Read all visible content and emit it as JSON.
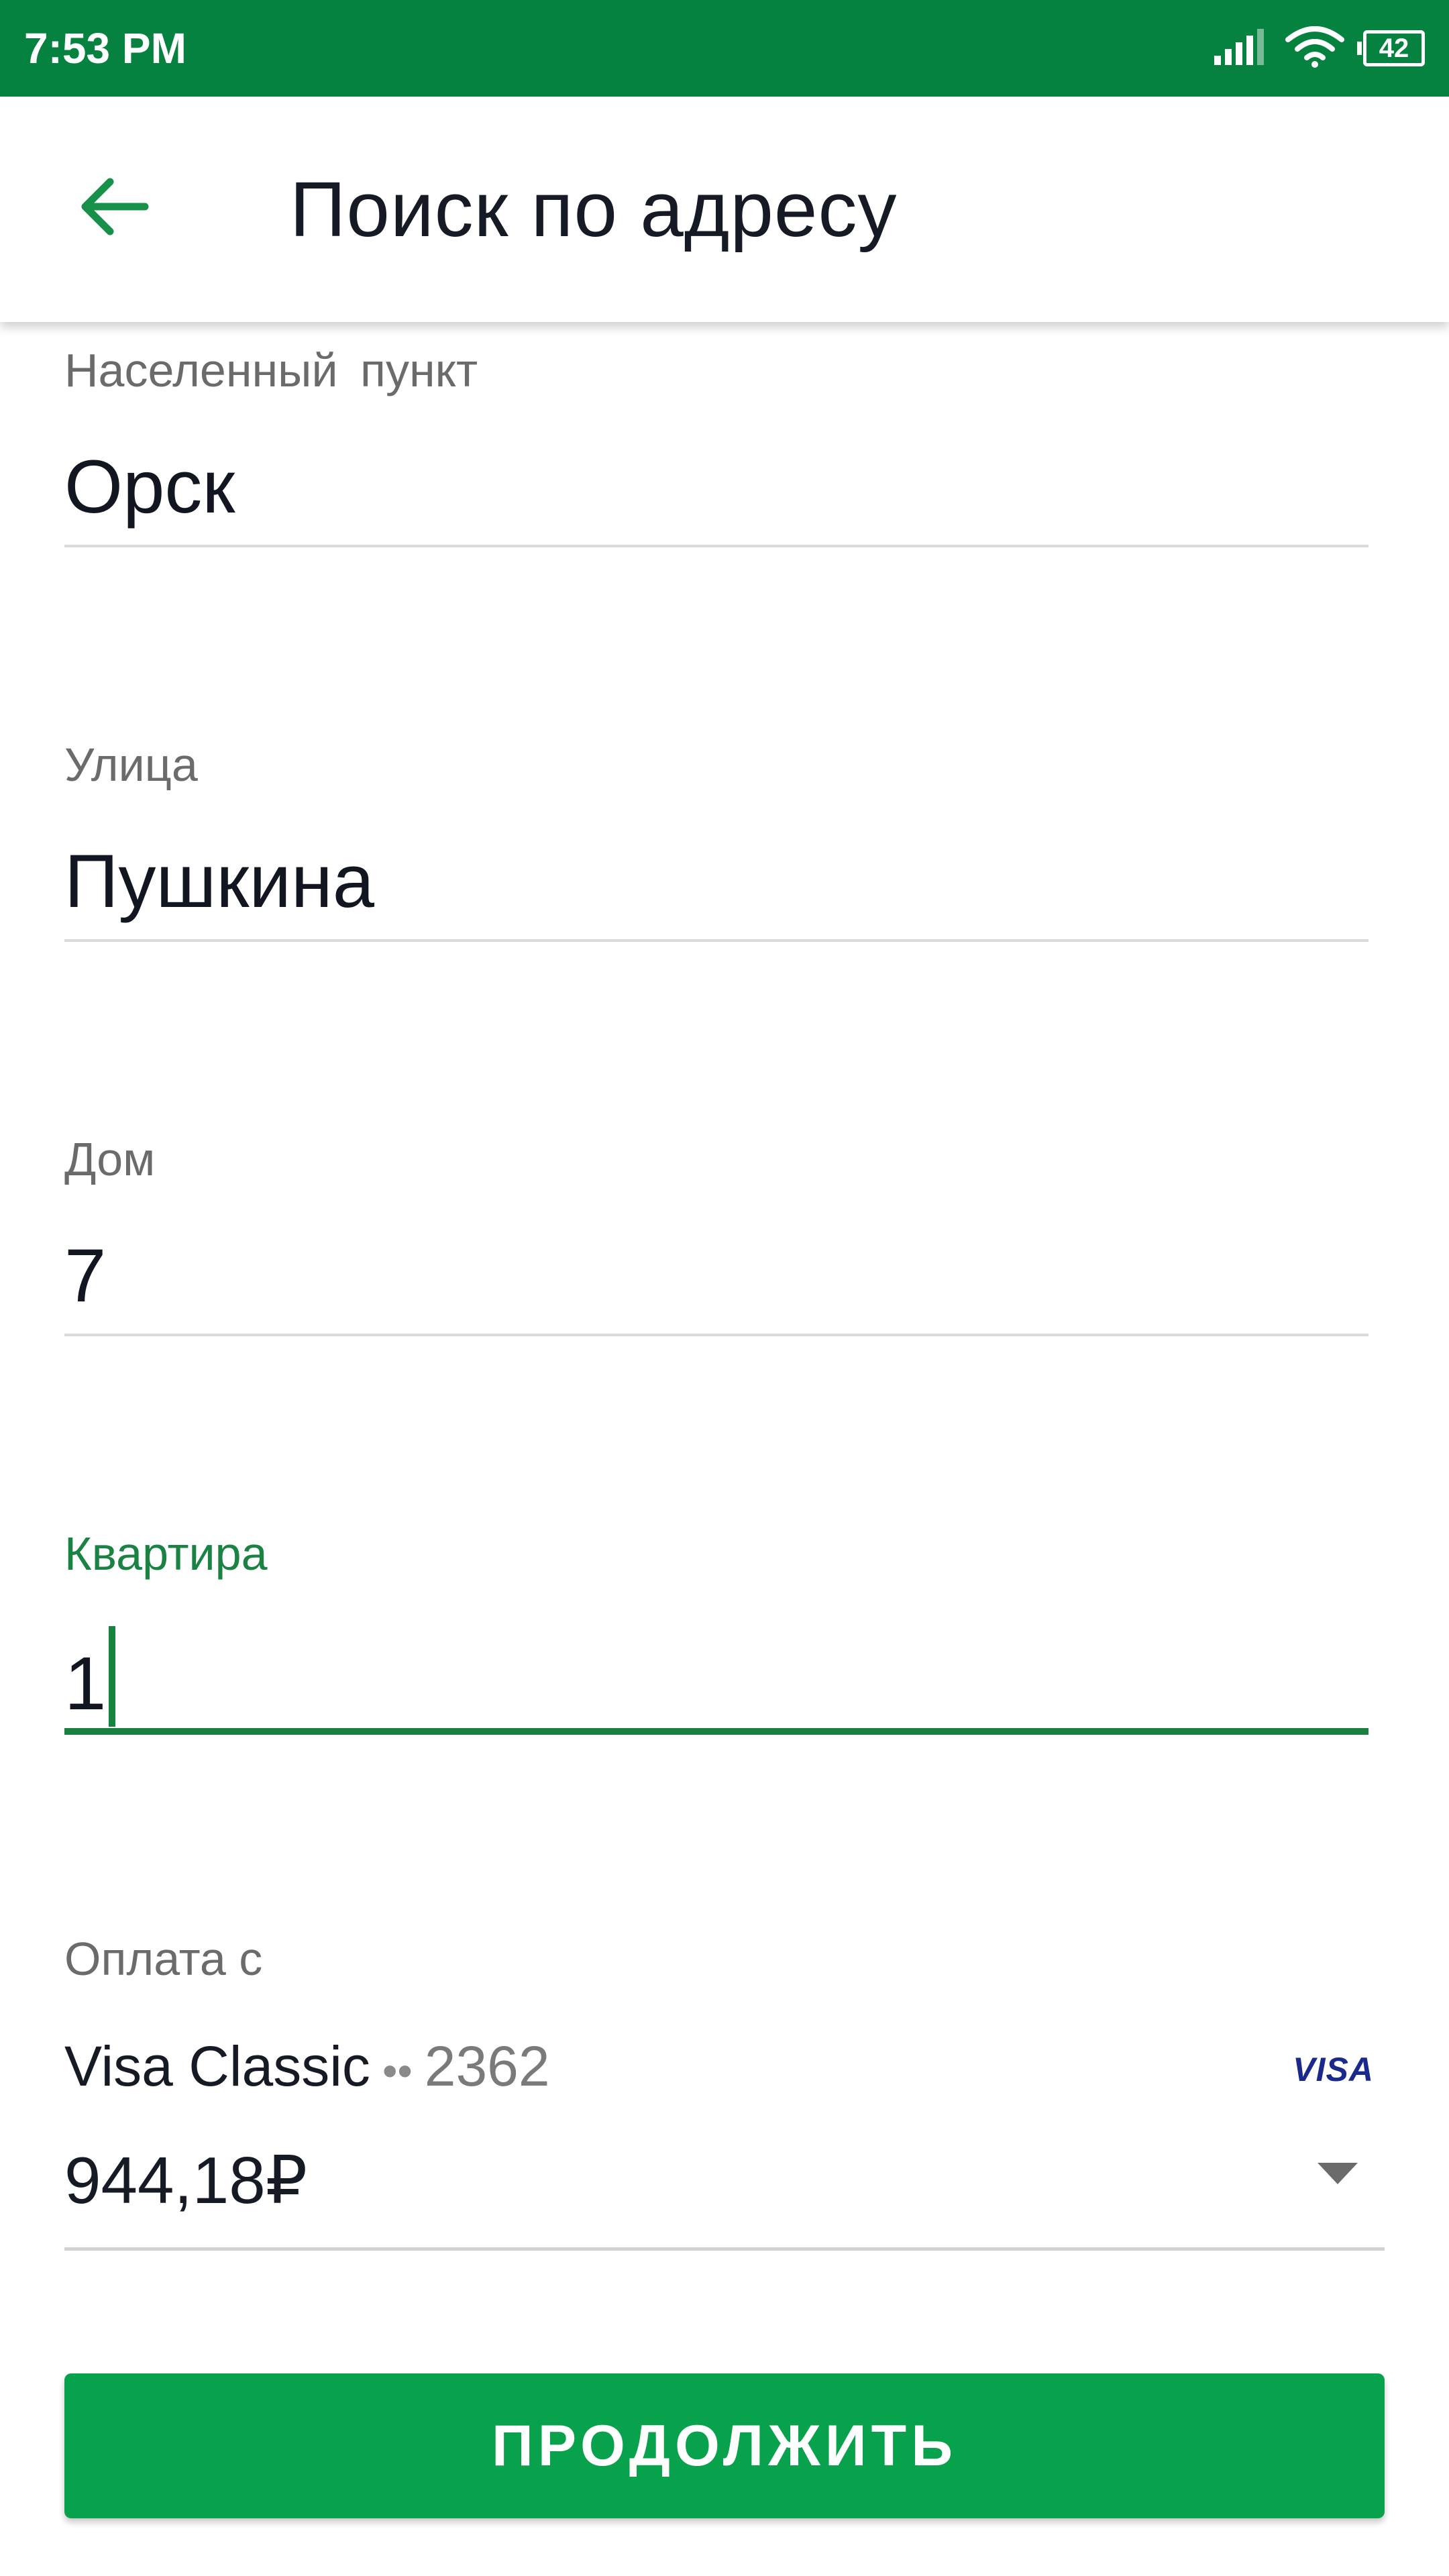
{
  "status_bar": {
    "time": "7:53 PM",
    "battery": "42",
    "icons": [
      "signal-icon",
      "wifi-icon",
      "battery-icon"
    ],
    "bg_color": "#068240"
  },
  "header": {
    "back_icon": "arrow-left-icon",
    "title": "Поиск по адресу"
  },
  "form": {
    "fields": [
      {
        "label": "Населенный пункт",
        "value": "Орск"
      },
      {
        "label": "Улица",
        "value": "Пушкина"
      },
      {
        "label": "Дом",
        "value": "7"
      },
      {
        "label": "Квартира",
        "value": "1",
        "focused": true
      }
    ]
  },
  "payment": {
    "label": "Оплата с",
    "card_name": "Visa Classic",
    "card_dots": "••",
    "card_number": "2362",
    "card_brand": "VISA",
    "balance": "944,18₽",
    "dropdown_icon": "chevron-down-icon"
  },
  "continue_button": {
    "label": "ПРОДОЛЖИТЬ"
  },
  "colors": {
    "accent": "#1a8344",
    "button": "#08a24c",
    "visa": "#1a2a8c"
  }
}
